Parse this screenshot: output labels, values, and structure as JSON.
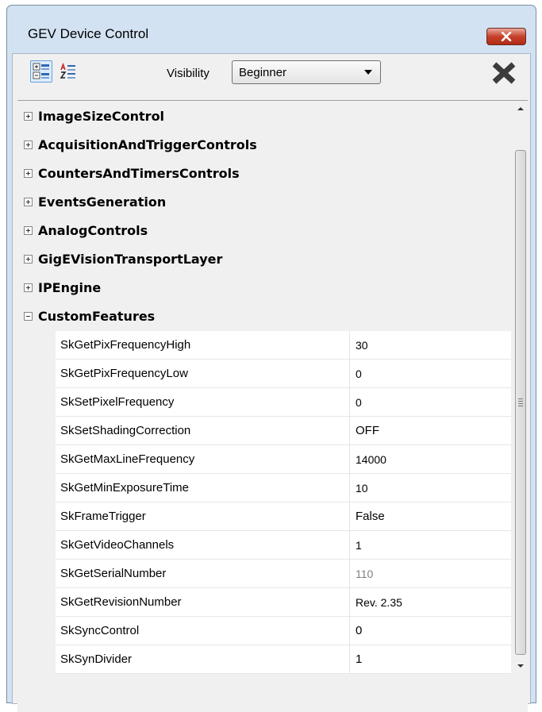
{
  "window": {
    "title": "GEV Device Control"
  },
  "toolbar": {
    "visibility_label": "Visibility",
    "visibility_value": "Beginner"
  },
  "categories": [
    {
      "label": "ImageSizeControl",
      "expanded": false
    },
    {
      "label": "AcquisitionAndTriggerControls",
      "expanded": false
    },
    {
      "label": "CountersAndTimersControls",
      "expanded": false
    },
    {
      "label": "EventsGeneration",
      "expanded": false
    },
    {
      "label": "AnalogControls",
      "expanded": false
    },
    {
      "label": "GigEVisionTransportLayer",
      "expanded": false
    },
    {
      "label": "IPEngine",
      "expanded": false
    },
    {
      "label": "CustomFeatures",
      "expanded": true
    }
  ],
  "properties": [
    {
      "name": "SkGetPixFrequencyHigh",
      "value": "30"
    },
    {
      "name": "SkGetPixFrequencyLow",
      "value": "0"
    },
    {
      "name": "SkSetPixelFrequency",
      "value": "0"
    },
    {
      "name": "SkSetShadingCorrection",
      "value": "OFF"
    },
    {
      "name": "SkGetMaxLineFrequency",
      "value": "14000"
    },
    {
      "name": "SkGetMinExposureTime",
      "value": "10"
    },
    {
      "name": "SkFrameTrigger",
      "value": "False"
    },
    {
      "name": "SkGetVideoChannels",
      "value": "1"
    },
    {
      "name": "SkGetSerialNumber",
      "value": "110"
    },
    {
      "name": "SkGetRevisionNumber",
      "value": "Rev. 2.35"
    },
    {
      "name": "SkSyncControl",
      "value": "0"
    },
    {
      "name": "SkSynDivider",
      "value": "1"
    }
  ],
  "icons": {
    "close": "close-icon",
    "categorized": "categorized-view-icon",
    "alphabetical": "sort-alphabetical-icon",
    "delete": "delete-x-icon",
    "dropdown": "chevron-down-icon"
  },
  "colors": {
    "close_button": "#c7412c",
    "window_frame": "#d3e2f2",
    "delete_icon": "#3c3c3c"
  }
}
